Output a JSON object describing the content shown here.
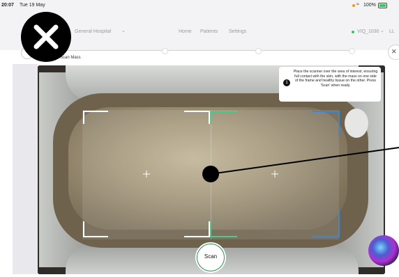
{
  "status_bar": {
    "time": "20:07",
    "date": "Tue 19 May",
    "battery": "100%"
  },
  "nav": {
    "hospital_name": "General Hospital",
    "menu": [
      "Home",
      "Patients",
      "Settings"
    ],
    "device_id": "VIQ_1030",
    "user_initials": "LL"
  },
  "stepper": {
    "current_step_label": "Scan Mass"
  },
  "tooltip": {
    "step_number": "1",
    "text": "Place the scanner over the area of interest, ensuring full contact with the skin, with the mass on one side of the frame and healthy tissue on the other. Press 'Scan' when ready."
  },
  "scan_button": {
    "label": "Scan"
  },
  "colors": {
    "status_green": "#34c759",
    "frame_green": "#44d08a",
    "frame_blue": "#3c88d8",
    "battery_orange": "#ff9500"
  }
}
